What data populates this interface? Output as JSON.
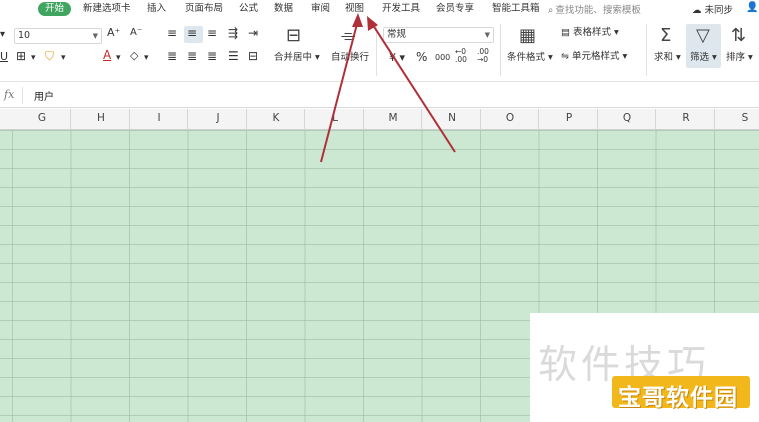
{
  "menu": {
    "items": [
      "开始",
      "新建选项卡",
      "插入",
      "页面布局",
      "公式",
      "数据",
      "审阅",
      "视图",
      "开发工具",
      "会员专享",
      "智能工具箱"
    ],
    "search_placeholder": "查找功能、搜索模板",
    "sync_label": "未同步"
  },
  "ribbon": {
    "font_size": "10",
    "merge_label": "合并居中",
    "wrap_label": "自动换行",
    "number_format": "常规",
    "conditional_format_label": "条件格式",
    "table_style_label": "表格样式",
    "cell_style_label": "单元格样式",
    "sum_label": "求和",
    "filter_label": "筛选",
    "sort_label": "排序",
    "percent": "%",
    "thousands": "000",
    "dec_inc": "←0 .00",
    "dec_dec": ".00 →0",
    "currency": "¥"
  },
  "formula_bar": {
    "fx": "fx",
    "value": "用户"
  },
  "columns": [
    "G",
    "H",
    "I",
    "J",
    "K",
    "L",
    "M",
    "N",
    "O",
    "P",
    "Q",
    "R",
    "S"
  ],
  "watermark": {
    "text": "软件技巧",
    "badge": "宝哥软件园"
  },
  "colors": {
    "active_tab": "#3fa560",
    "grid_fill": "#cce8d2",
    "arrow": "#b0303a",
    "badge": "#f2b71a"
  }
}
